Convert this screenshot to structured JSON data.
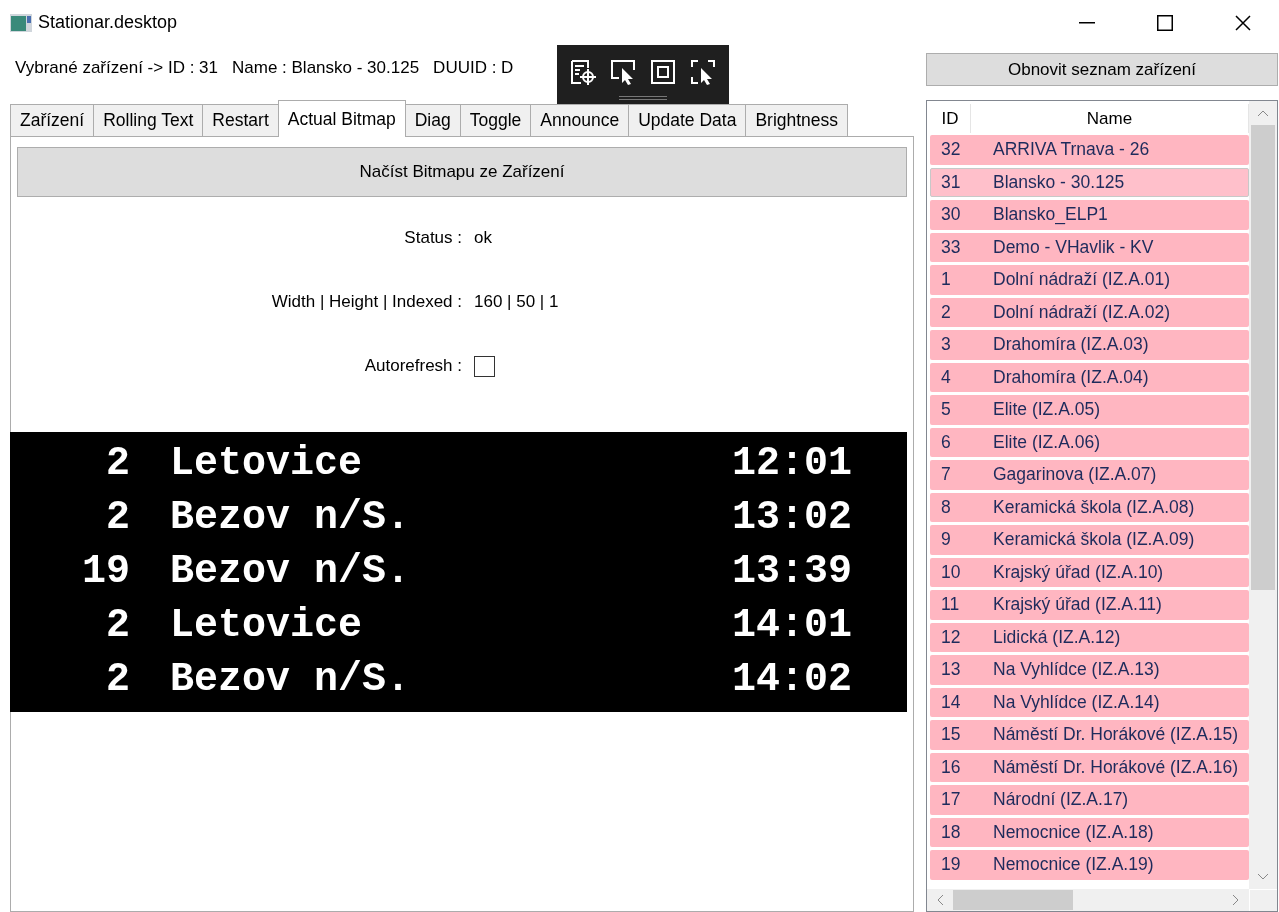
{
  "window": {
    "title": "Stationar.desktop"
  },
  "selected_device": [
    "Vybrané zařízení -> ID : 31",
    "Name : Blansko - 30.125",
    "DUUID : D"
  ],
  "tabs": [
    {
      "label": "Zařízení",
      "selected": false
    },
    {
      "label": "Rolling Text",
      "selected": false
    },
    {
      "label": "Restart",
      "selected": false
    },
    {
      "label": "Actual Bitmap",
      "selected": true
    },
    {
      "label": "Diag",
      "selected": false
    },
    {
      "label": "Toggle",
      "selected": false
    },
    {
      "label": "Announce",
      "selected": false
    },
    {
      "label": "Update Data",
      "selected": false
    },
    {
      "label": "Brightness",
      "selected": false
    }
  ],
  "load_button": "Načíst Bitmapu ze Zařízení",
  "fields": [
    {
      "label": "Status :",
      "value": "ok"
    },
    {
      "label": "Width | Height | Indexed :",
      "value": "160 | 50 | 1"
    }
  ],
  "autorefresh": {
    "label": "Autorefresh :",
    "checked": false
  },
  "bitmap": {
    "rows": [
      {
        "line": "2",
        "destination": "Letovice",
        "time": "12:01"
      },
      {
        "line": "2",
        "destination": "Bezov n/S.",
        "time": "13:02"
      },
      {
        "line": "19",
        "destination": "Bezov n/S.",
        "time": "13:39"
      },
      {
        "line": "2",
        "destination": "Letovice",
        "time": "14:01"
      },
      {
        "line": "2",
        "destination": "Bezov n/S.",
        "time": "14:02"
      }
    ]
  },
  "refresh_button": "Obnovit seznam zařízení",
  "devices": {
    "columns": [
      "ID",
      "Name"
    ],
    "rows": [
      {
        "id": "32",
        "name": "ARRIVA Trnava - 26",
        "selected": false
      },
      {
        "id": "31",
        "name": "Blansko - 30.125",
        "selected": true
      },
      {
        "id": "30",
        "name": "Blansko_ELP1",
        "selected": false
      },
      {
        "id": "33",
        "name": "Demo - VHavlik - KV",
        "selected": false
      },
      {
        "id": "1",
        "name": "Dolní nádraží (IZ.A.01)",
        "selected": false
      },
      {
        "id": "2",
        "name": "Dolní nádraží (IZ.A.02)",
        "selected": false
      },
      {
        "id": "3",
        "name": "Drahomíra (IZ.A.03)",
        "selected": false
      },
      {
        "id": "4",
        "name": "Drahomíra (IZ.A.04)",
        "selected": false
      },
      {
        "id": "5",
        "name": "Elite (IZ.A.05)",
        "selected": false
      },
      {
        "id": "6",
        "name": "Elite (IZ.A.06)",
        "selected": false
      },
      {
        "id": "7",
        "name": "Gagarinova (IZ.A.07)",
        "selected": false
      },
      {
        "id": "8",
        "name": "Keramická škola (IZ.A.08)",
        "selected": false
      },
      {
        "id": "9",
        "name": "Keramická škola (IZ.A.09)",
        "selected": false
      },
      {
        "id": "10",
        "name": "Krajský úřad (IZ.A.10)",
        "selected": false
      },
      {
        "id": "11",
        "name": "Krajský úřad (IZ.A.11)",
        "selected": false
      },
      {
        "id": "12",
        "name": "Lidická (IZ.A.12)",
        "selected": false
      },
      {
        "id": "13",
        "name": "Na Vyhlídce (IZ.A.13)",
        "selected": false
      },
      {
        "id": "14",
        "name": "Na Vyhlídce (IZ.A.14)",
        "selected": false
      },
      {
        "id": "15",
        "name": "Náměstí Dr. Horákové (IZ.A.15)",
        "selected": false
      },
      {
        "id": "16",
        "name": "Náměstí Dr. Horákové (IZ.A.16)",
        "selected": false
      },
      {
        "id": "17",
        "name": "Národní (IZ.A.17)",
        "selected": false
      },
      {
        "id": "18",
        "name": "Nemocnice (IZ.A.18)",
        "selected": false
      },
      {
        "id": "19",
        "name": "Nemocnice (IZ.A.19)",
        "selected": false
      }
    ]
  }
}
